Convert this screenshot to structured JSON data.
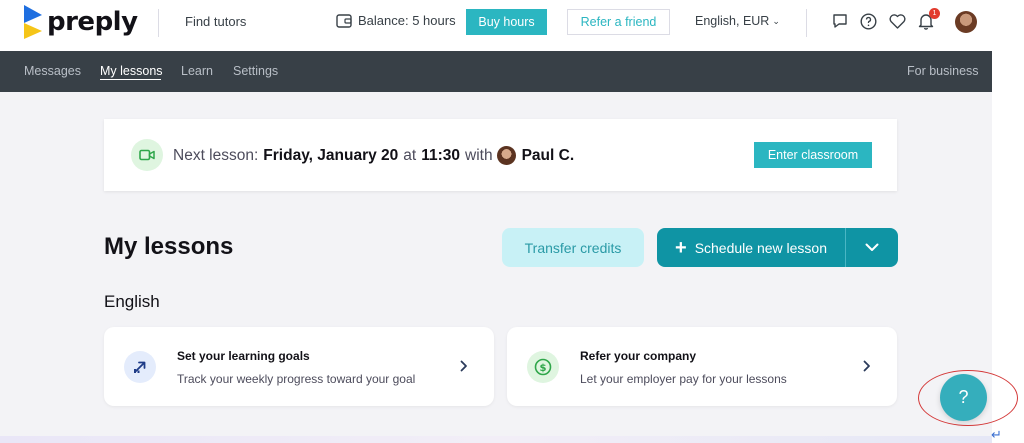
{
  "header": {
    "logo_text": "preply",
    "find_tutors": "Find tutors",
    "balance": "Balance: 5 hours",
    "buy_hours": "Buy hours",
    "refer_friend": "Refer a friend",
    "language": "English, EUR",
    "notification_count": "1"
  },
  "nav": {
    "items": [
      {
        "label": "Messages"
      },
      {
        "label": "My lessons"
      },
      {
        "label": "Learn"
      },
      {
        "label": "Settings"
      }
    ],
    "for_business": "For business"
  },
  "next_lesson": {
    "prefix": "Next lesson:",
    "date": "Friday, January 20",
    "at": "at",
    "time": "11:30",
    "with": "with",
    "tutor": "Paul C.",
    "enter_button": "Enter classroom"
  },
  "lessons": {
    "title": "My lessons",
    "transfer_button": "Transfer credits",
    "schedule_button": "Schedule new lesson",
    "section": "English"
  },
  "cards": [
    {
      "title": "Set your learning goals",
      "subtitle": "Track your weekly progress toward your goal",
      "icon": "goal-arrow-icon"
    },
    {
      "title": "Refer your company",
      "subtitle": "Let your employer pay for your lessons",
      "icon": "dollar-coin-icon"
    }
  ],
  "help": {
    "label": "?"
  },
  "colors": {
    "accent": "#2bb6c1",
    "primary_dark": "#0f94a4",
    "nav_bg": "#384047",
    "page_bg": "#f3f3f6"
  }
}
